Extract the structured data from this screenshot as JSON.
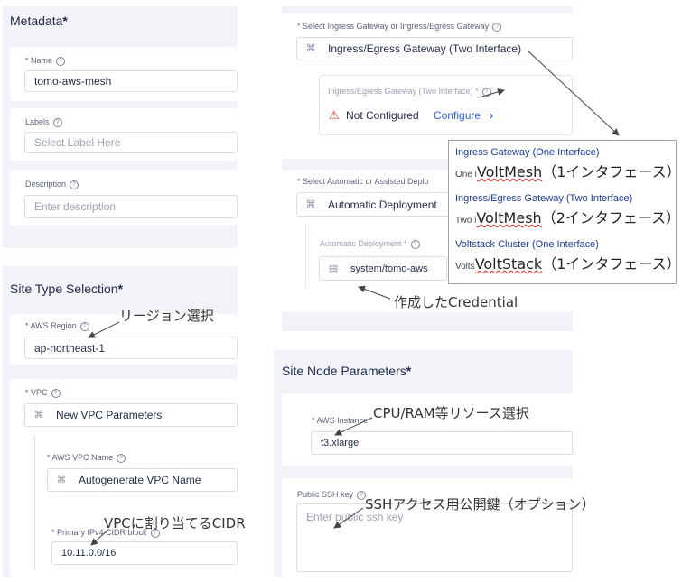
{
  "metadata": {
    "heading": "Metadata",
    "name_label": "* Name",
    "name_value": "tomo-aws-mesh",
    "labels_label": "Labels",
    "labels_placeholder": "Select Label Here",
    "description_label": "Description",
    "description_placeholder": "Enter description"
  },
  "site_type": {
    "heading": "Site Type Selection",
    "aws_region_label": "* AWS Region",
    "aws_region_value": "ap-northeast-1",
    "vpc_label": "* VPC",
    "vpc_value": "New VPC Parameters",
    "vpc_name_label": "* AWS VPC Name",
    "vpc_name_value": "Autogenerate VPC Name",
    "cidr_label": "* Primary IPv4 CIDR block",
    "cidr_value": "10.11.0.0/16"
  },
  "ingress": {
    "select_label": "* Select Ingress Gateway or Ingress/Egress Gateway",
    "select_value": "Ingress/Egress Gateway (Two Interface)",
    "sub_label": "Ingress/Egress Gateway (Two Interface) *",
    "status": "Not Configured",
    "configure_link": "Configure",
    "configure_chevron": "›"
  },
  "deployment": {
    "select_label": "* Select Automatic or Assisted Deplo",
    "select_value": "Automatic Deployment",
    "sub_label": "Automatic Deployment *",
    "credential_value": "system/tomo-aws"
  },
  "node_params": {
    "heading": "Site Node Parameters",
    "instance_label": "* AWS Instance",
    "instance_value": "t3.xlarge",
    "ssh_label": "Public SSH key",
    "ssh_placeholder": "Enter public ssh key"
  },
  "dropdown": {
    "items": [
      {
        "title": "Ingress Gateway (One Interface)",
        "sub_prefix": "One i",
        "big": "VoltMesh",
        "big_suffix": "（1インタフェース）"
      },
      {
        "title": "Ingress/Egress Gateway (Two Interface)",
        "sub_prefix": "Two i",
        "big": "VoltMesh",
        "big_suffix": "（2インタフェース）"
      },
      {
        "title": "Voltstack Cluster (One Interface)",
        "sub_prefix": "Volts",
        "big": "VoltStack",
        "big_suffix": "（1インタフェース）"
      }
    ]
  },
  "annotations": {
    "region": "リージョン選択",
    "cidr": "VPCに割り当てるCIDR",
    "credential": "作成したCredential",
    "instance": "CPU/RAM等リソース選択",
    "ssh": "SSHアクセス用公開鍵（オプション）"
  },
  "required_mark": "*",
  "help_mark": "?"
}
